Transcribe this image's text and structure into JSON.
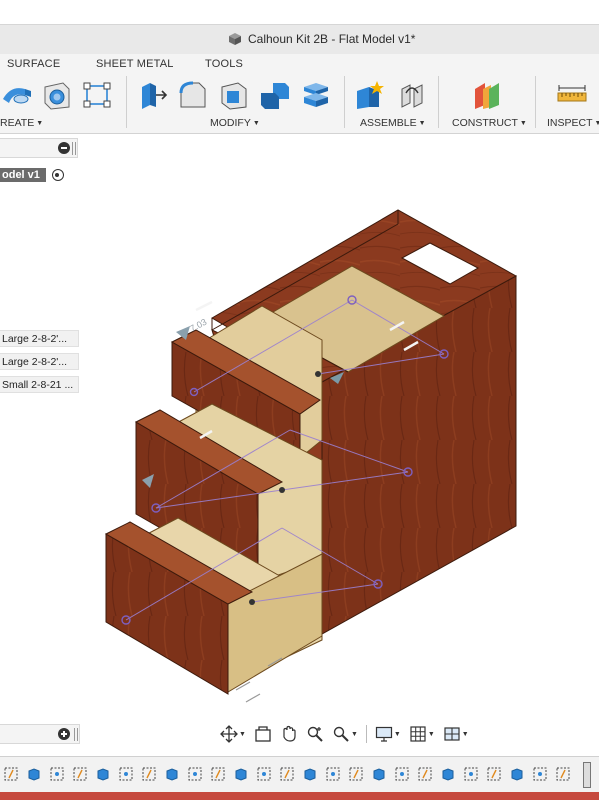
{
  "window": {
    "title": "Calhoun Kit 2B - Flat Model v1*"
  },
  "toolbar": {
    "tabs": [
      {
        "label": "SURFACE"
      },
      {
        "label": "SHEET METAL"
      },
      {
        "label": "TOOLS"
      }
    ],
    "groups": [
      {
        "label": "REATE"
      },
      {
        "label": "MODIFY"
      },
      {
        "label": "ASSEMBLE"
      },
      {
        "label": "CONSTRUCT"
      },
      {
        "label": "INSPECT"
      }
    ],
    "tools": [
      {
        "icon": "sweep-icon"
      },
      {
        "icon": "hole-icon"
      },
      {
        "icon": "sketch-rectangle-icon"
      },
      {
        "icon": "press-pull-icon"
      },
      {
        "icon": "fillet-icon"
      },
      {
        "icon": "shell-icon"
      },
      {
        "icon": "combine-icon"
      },
      {
        "icon": "modify-stack-icon"
      },
      {
        "icon": "new-component-icon"
      },
      {
        "icon": "joint-icon"
      },
      {
        "icon": "offset-plane-icon"
      },
      {
        "icon": "measure-icon"
      }
    ],
    "accent": "#2e86d6"
  },
  "browser": {
    "model_label": "odel v1",
    "components": [
      {
        "label": "Large 2-8-2'..."
      },
      {
        "label": "Large 2-8-2'..."
      },
      {
        "label": "Small 2-8-21 ..."
      }
    ]
  },
  "viewport": {
    "annotation": "7.03",
    "wood_color": "#8b3a1f",
    "interior_color": "#d9c28e"
  },
  "navbar": {
    "items": [
      {
        "icon": "orbit-icon",
        "has_menu": true
      },
      {
        "icon": "look-at-icon",
        "has_menu": false
      },
      {
        "icon": "pan-hand-icon",
        "has_menu": false
      },
      {
        "icon": "zoom-icon",
        "has_menu": false
      },
      {
        "icon": "zoom-window-icon",
        "has_menu": true
      },
      {
        "icon": "display-settings-icon",
        "has_menu": true
      },
      {
        "icon": "grid-icon",
        "has_menu": true
      },
      {
        "icon": "viewports-icon",
        "has_menu": true
      }
    ]
  },
  "timeline": {
    "feature_count": 25
  }
}
